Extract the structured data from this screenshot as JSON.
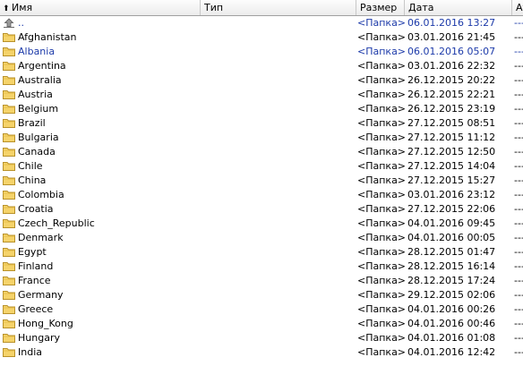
{
  "columns": {
    "name": "Имя",
    "type": "Тип",
    "size": "Размер",
    "date": "Дата",
    "attr": "Атри"
  },
  "rows": [
    {
      "name": "..",
      "icon": "up-folder-icon",
      "size": "<Папка>",
      "date": "06.01.2016 13:27",
      "attr": "----",
      "highlight": true
    },
    {
      "name": "Afghanistan",
      "icon": "folder-icon",
      "size": "<Папка>",
      "date": "03.01.2016 21:45",
      "attr": "----"
    },
    {
      "name": "Albania",
      "icon": "folder-icon",
      "size": "<Папка>",
      "date": "06.01.2016 05:07",
      "attr": "----",
      "highlight": true
    },
    {
      "name": "Argentina",
      "icon": "folder-icon",
      "size": "<Папка>",
      "date": "03.01.2016 22:32",
      "attr": "----"
    },
    {
      "name": "Australia",
      "icon": "folder-icon",
      "size": "<Папка>",
      "date": "26.12.2015 20:22",
      "attr": "----"
    },
    {
      "name": "Austria",
      "icon": "folder-icon",
      "size": "<Папка>",
      "date": "26.12.2015 22:21",
      "attr": "----"
    },
    {
      "name": "Belgium",
      "icon": "folder-icon",
      "size": "<Папка>",
      "date": "26.12.2015 23:19",
      "attr": "----"
    },
    {
      "name": "Brazil",
      "icon": "folder-icon",
      "size": "<Папка>",
      "date": "27.12.2015 08:51",
      "attr": "----"
    },
    {
      "name": "Bulgaria",
      "icon": "folder-icon",
      "size": "<Папка>",
      "date": "27.12.2015 11:12",
      "attr": "----"
    },
    {
      "name": "Canada",
      "icon": "folder-icon",
      "size": "<Папка>",
      "date": "27.12.2015 12:50",
      "attr": "----"
    },
    {
      "name": "Chile",
      "icon": "folder-icon",
      "size": "<Папка>",
      "date": "27.12.2015 14:04",
      "attr": "----"
    },
    {
      "name": "China",
      "icon": "folder-icon",
      "size": "<Папка>",
      "date": "27.12.2015 15:27",
      "attr": "----"
    },
    {
      "name": "Colombia",
      "icon": "folder-icon",
      "size": "<Папка>",
      "date": "03.01.2016 23:12",
      "attr": "----"
    },
    {
      "name": "Croatia",
      "icon": "folder-icon",
      "size": "<Папка>",
      "date": "27.12.2015 22:06",
      "attr": "----"
    },
    {
      "name": "Czech_Republic",
      "icon": "folder-icon",
      "size": "<Папка>",
      "date": "04.01.2016 09:45",
      "attr": "----"
    },
    {
      "name": "Denmark",
      "icon": "folder-icon",
      "size": "<Папка>",
      "date": "04.01.2016 00:05",
      "attr": "----"
    },
    {
      "name": "Egypt",
      "icon": "folder-icon",
      "size": "<Папка>",
      "date": "28.12.2015 01:47",
      "attr": "----"
    },
    {
      "name": "Finland",
      "icon": "folder-icon",
      "size": "<Папка>",
      "date": "28.12.2015 16:14",
      "attr": "----"
    },
    {
      "name": "France",
      "icon": "folder-icon",
      "size": "<Папка>",
      "date": "28.12.2015 17:24",
      "attr": "----"
    },
    {
      "name": "Germany",
      "icon": "folder-icon",
      "size": "<Папка>",
      "date": "29.12.2015 02:06",
      "attr": "----"
    },
    {
      "name": "Greece",
      "icon": "folder-icon",
      "size": "<Папка>",
      "date": "04.01.2016 00:26",
      "attr": "----"
    },
    {
      "name": "Hong_Kong",
      "icon": "folder-icon",
      "size": "<Папка>",
      "date": "04.01.2016 00:46",
      "attr": "----"
    },
    {
      "name": "Hungary",
      "icon": "folder-icon",
      "size": "<Папка>",
      "date": "04.01.2016 01:08",
      "attr": "----"
    },
    {
      "name": "India",
      "icon": "folder-icon",
      "size": "<Папка>",
      "date": "04.01.2016 12:42",
      "attr": "----"
    }
  ],
  "colors": {
    "highlight": "#1c3aa9",
    "folder": "#f5d36a"
  }
}
